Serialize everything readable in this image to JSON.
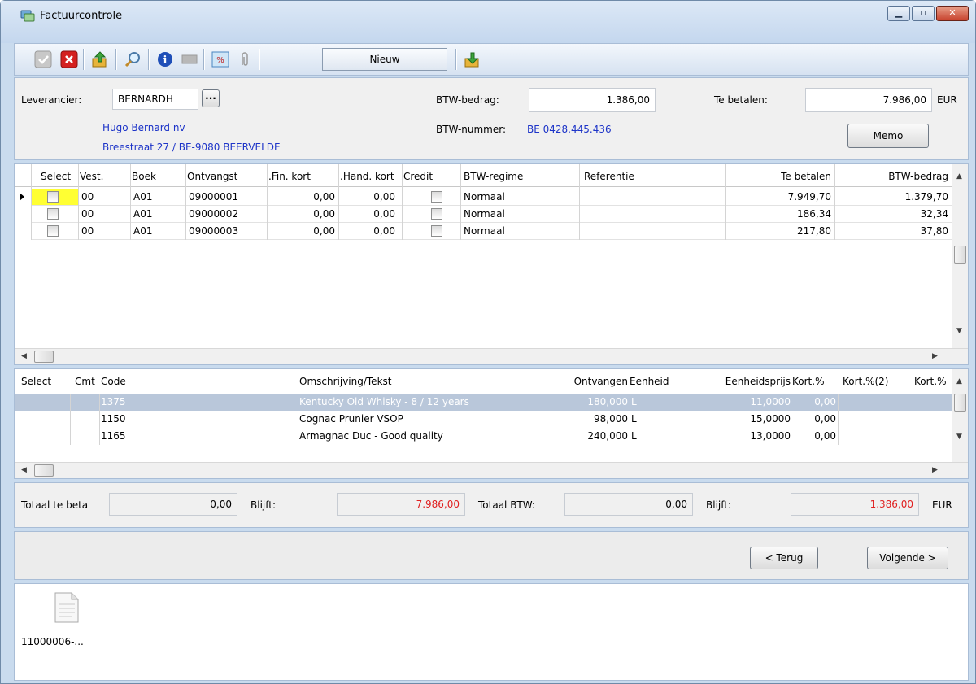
{
  "window": {
    "title": "Factuurcontrole",
    "buttons": [
      "minimize",
      "maximize",
      "close"
    ]
  },
  "toolbar": {
    "nieuw": "Nieuw",
    "icons": [
      "check-icon",
      "cancel-icon",
      "export-icon",
      "search-icon",
      "info-icon",
      "blank-icon",
      "percent-icon",
      "attachment-icon",
      "import-icon"
    ]
  },
  "header": {
    "leverancier_label": "Leverancier:",
    "leverancier_value": "BERNARDH",
    "lookup_label": "...",
    "supplier_name": "Hugo Bernard nv",
    "supplier_address": "Breestraat 27 / BE-9080 BEERVELDE",
    "btw_bedrag_label": "BTW-bedrag:",
    "btw_bedrag_value": "1.386,00",
    "btw_nummer_label": "BTW-nummer:",
    "btw_nummer_value": "BE 0428.445.436",
    "te_betalen_label": "Te betalen:",
    "te_betalen_value": "7.986,00",
    "currency": "EUR",
    "memo": "Memo"
  },
  "invoices": {
    "columns": [
      "Select",
      "Vest.",
      "Boek",
      "Ontvangst",
      "Fin. kort.",
      "Hand. kort.",
      "Credit",
      "BTW-regime",
      "Referentie",
      "Te betalen",
      "BTW-bedrag"
    ],
    "rows": [
      {
        "vest": "00",
        "boek": "A01",
        "ontvangst": "09000001",
        "fin": "0,00",
        "hand": "0,00",
        "regime": "Normaal",
        "referentie": "",
        "te_betalen": "7.949,70",
        "btw": "1.379,70"
      },
      {
        "vest": "00",
        "boek": "A01",
        "ontvangst": "09000002",
        "fin": "0,00",
        "hand": "0,00",
        "regime": "Normaal",
        "referentie": "",
        "te_betalen": "186,34",
        "btw": "32,34"
      },
      {
        "vest": "00",
        "boek": "A01",
        "ontvangst": "09000003",
        "fin": "0,00",
        "hand": "0,00",
        "regime": "Normaal",
        "referentie": "",
        "te_betalen": "217,80",
        "btw": "37,80"
      }
    ]
  },
  "lines": {
    "columns": [
      "Select",
      "Cmt",
      "Code",
      "Omschrijving/Tekst",
      "Ontvangen",
      "Eenheid",
      "Eenheidsprijs",
      "Kort.%",
      "Kort.%(2)",
      "Kort.%"
    ],
    "rows": [
      {
        "code": "1375",
        "omschrijving": "Kentucky Old Whisky - 8 / 12 years",
        "ontvangen": "180,000",
        "eenheid": "L",
        "prijs": "11,0000",
        "kort": "0,00"
      },
      {
        "code": "1150",
        "omschrijving": "Cognac Prunier VSOP",
        "ontvangen": "98,000",
        "eenheid": "L",
        "prijs": "15,0000",
        "kort": "0,00"
      },
      {
        "code": "1165",
        "omschrijving": "Armagnac Duc - Good quality",
        "ontvangen": "240,000",
        "eenheid": "L",
        "prijs": "13,0000",
        "kort": "0,00"
      }
    ]
  },
  "totals": {
    "totaal_label": "Totaal te beta",
    "totaal_value": "0,00",
    "blijft1_label": "Blijft:",
    "blijft1_value": "7.986,00",
    "totaal_btw_label": "Totaal BTW:",
    "totaal_btw_value": "0,00",
    "blijft2_label": "Blijft:",
    "blijft2_value": "1.386,00",
    "currency": "EUR"
  },
  "nav": {
    "back": "< Terug",
    "next": "Volgende >"
  },
  "attachment": {
    "filename": "11000006-..."
  }
}
